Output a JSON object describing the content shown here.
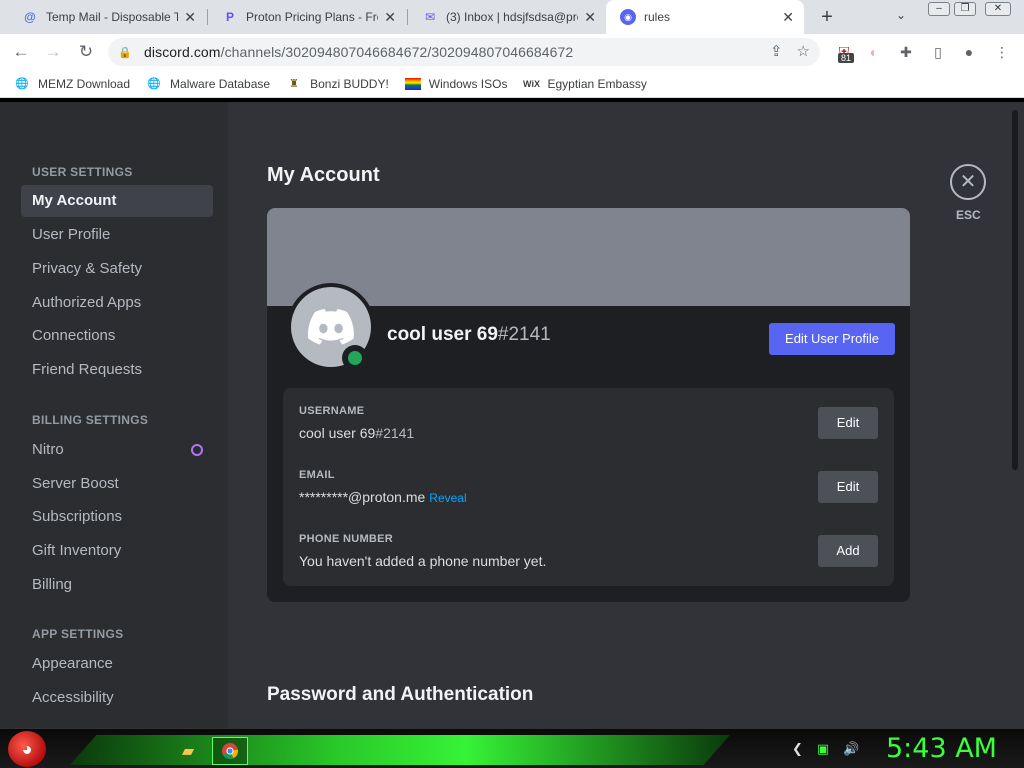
{
  "browser": {
    "tabs": [
      {
        "title": "Temp Mail - Disposable Te",
        "icon": "at-icon"
      },
      {
        "title": "Proton Pricing Plans - Fre",
        "icon": "proton-icon"
      },
      {
        "title": "(3) Inbox | hdsjfsdsa@pro",
        "icon": "proton-mail-icon"
      },
      {
        "title": "rules",
        "icon": "discord-icon"
      }
    ],
    "address": {
      "host": "discord.com",
      "path": "/channels/302094807046684672/302094807046684672"
    },
    "extension_badge": "81",
    "bookmarks": [
      {
        "label": "MEMZ Download"
      },
      {
        "label": "Malware Database"
      },
      {
        "label": "Bonzi BUDDY!"
      },
      {
        "label": "Windows ISOs"
      },
      {
        "label": "Egyptian Embassy"
      }
    ]
  },
  "sidebar": {
    "user_settings_header": "USER SETTINGS",
    "user_items": [
      {
        "label": "My Account"
      },
      {
        "label": "User Profile"
      },
      {
        "label": "Privacy & Safety"
      },
      {
        "label": "Authorized Apps"
      },
      {
        "label": "Connections"
      },
      {
        "label": "Friend Requests"
      }
    ],
    "billing_settings_header": "BILLING SETTINGS",
    "billing_items": [
      {
        "label": "Nitro"
      },
      {
        "label": "Server Boost"
      },
      {
        "label": "Subscriptions"
      },
      {
        "label": "Gift Inventory"
      },
      {
        "label": "Billing"
      }
    ],
    "app_settings_header": "APP SETTINGS",
    "app_items": [
      {
        "label": "Appearance"
      },
      {
        "label": "Accessibility"
      }
    ]
  },
  "account": {
    "page_title": "My Account",
    "username": "cool user 69",
    "discriminator": "#2141",
    "edit_profile_label": "Edit User Profile",
    "fields": {
      "username_label": "USERNAME",
      "username_value": "cool user 69",
      "username_disc": "#2141",
      "username_btn": "Edit",
      "email_label": "EMAIL",
      "email_value": "*********@proton.me",
      "email_reveal": "Reveal",
      "email_btn": "Edit",
      "phone_label": "PHONE NUMBER",
      "phone_value": "You haven't added a phone number yet.",
      "phone_btn": "Add"
    },
    "section_title": "Password and Authentication",
    "close_label": "ESC"
  },
  "taskbar": {
    "clock": "5:43 AM"
  },
  "colors": {
    "discord_blurple": "#5865f2",
    "online_green": "#23a55a",
    "link_blue": "#00a8fc",
    "taskbar_glow": "#38ff38"
  }
}
